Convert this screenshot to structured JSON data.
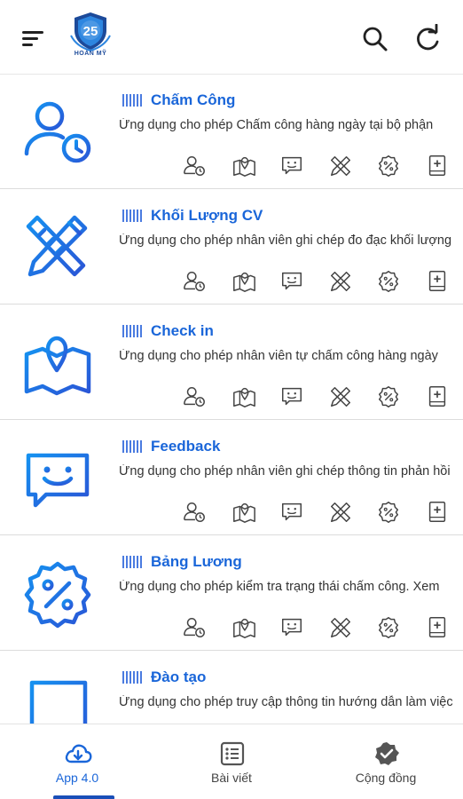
{
  "header": {
    "logo_number": "25",
    "logo_text": "HOÀN MỸ"
  },
  "apps": [
    {
      "title": "Chấm Công",
      "description": "Ứng dụng cho phép Chấm công hàng ngày tại bộ phận",
      "icon": "user-clock-icon"
    },
    {
      "title": "Khối Lượng CV",
      "description": "Ứng dụng cho phép nhân viên ghi chép đo đạc khối lượng",
      "icon": "ruler-pencil-icon"
    },
    {
      "title": "Check in",
      "description": "Ứng dụng cho phép nhân viên tự chấm công hàng ngày",
      "icon": "map-pin-icon"
    },
    {
      "title": "Feedback",
      "description": "Ứng dụng cho phép nhân viên ghi chép thông tin phản hồi",
      "icon": "chat-smile-icon"
    },
    {
      "title": "Bảng Lương",
      "description": "Ứng dụng cho phép kiểm tra trạng thái chấm công. Xem",
      "icon": "percent-badge-icon"
    },
    {
      "title": "Đào tạo",
      "description": "Ứng dụng cho phép truy cập thông tin hướng dẫn làm việc",
      "icon": "book-plus-icon"
    }
  ],
  "nav": {
    "tabs": [
      {
        "label": "App 4.0",
        "icon": "cloud-download-icon",
        "active": true
      },
      {
        "label": "Bài viết",
        "icon": "list-icon",
        "active": false
      },
      {
        "label": "Cộng đồng",
        "icon": "verified-badge-icon",
        "active": false
      }
    ]
  },
  "colors": {
    "accent": "#1a66d9",
    "icon_gradient_start": "#0a7fe0",
    "icon_gradient_end": "#2a4fd0",
    "indicator": "#1a4fb8"
  }
}
